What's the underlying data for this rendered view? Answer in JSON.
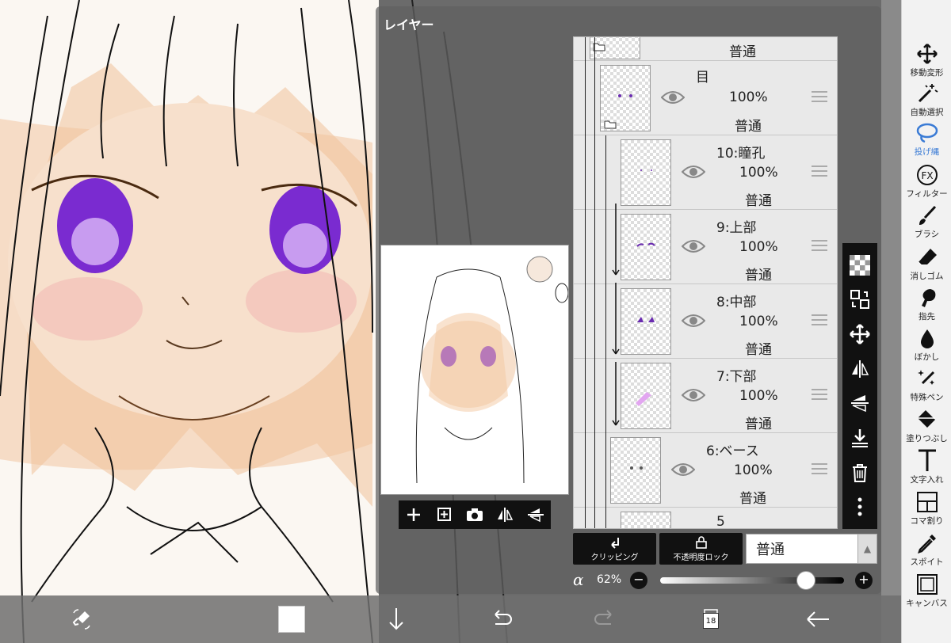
{
  "panel": {
    "title": "レイヤー"
  },
  "layers": [
    {
      "name": "",
      "opacity": "",
      "mode": "普通",
      "kind": "folder-collapsed"
    },
    {
      "name": "目",
      "opacity": "100%",
      "mode": "普通",
      "kind": "folder"
    },
    {
      "name": "10:瞳孔",
      "opacity": "100%",
      "mode": "普通"
    },
    {
      "name": "9:上部",
      "opacity": "100%",
      "mode": "普通"
    },
    {
      "name": "8:中部",
      "opacity": "100%",
      "mode": "普通"
    },
    {
      "name": "7:下部",
      "opacity": "100%",
      "mode": "普通"
    },
    {
      "name": "6:ベース",
      "opacity": "100%",
      "mode": "普通"
    },
    {
      "name": "5",
      "opacity": "",
      "mode": ""
    }
  ],
  "layer_controls": {
    "clipping_label": "クリッピング",
    "lock_label": "不透明度ロック",
    "blend_mode": "普通",
    "alpha_symbol": "α",
    "alpha_value": "62%",
    "alpha_fraction": 0.62
  },
  "tools": [
    {
      "label": "移動変形",
      "icon": "move-transform-icon"
    },
    {
      "label": "自動選択",
      "icon": "magic-wand-icon"
    },
    {
      "label": "投げ縄",
      "icon": "lasso-icon",
      "active": true
    },
    {
      "label": "フィルター",
      "icon": "fx-icon"
    },
    {
      "label": "ブラシ",
      "icon": "brush-icon"
    },
    {
      "label": "消しゴム",
      "icon": "eraser-icon"
    },
    {
      "label": "指先",
      "icon": "smudge-icon"
    },
    {
      "label": "ぼかし",
      "icon": "blur-icon"
    },
    {
      "label": "特殊ペン",
      "icon": "special-pen-icon"
    },
    {
      "label": "塗りつぶし",
      "icon": "fill-bucket-icon"
    },
    {
      "label": "文字入れ",
      "icon": "text-icon"
    },
    {
      "label": "コマ割り",
      "icon": "frame-divider-icon"
    },
    {
      "label": "スポイト",
      "icon": "eyedropper-icon"
    },
    {
      "label": "キャンバス",
      "icon": "canvas-icon"
    }
  ],
  "bottom_bar": {
    "page_count": "18",
    "primary_color": "#ffffff"
  },
  "colors": {
    "accent": "#3a7bd5",
    "panel_bg": "#606060",
    "toolbar_bg": "#f2f2f2"
  }
}
